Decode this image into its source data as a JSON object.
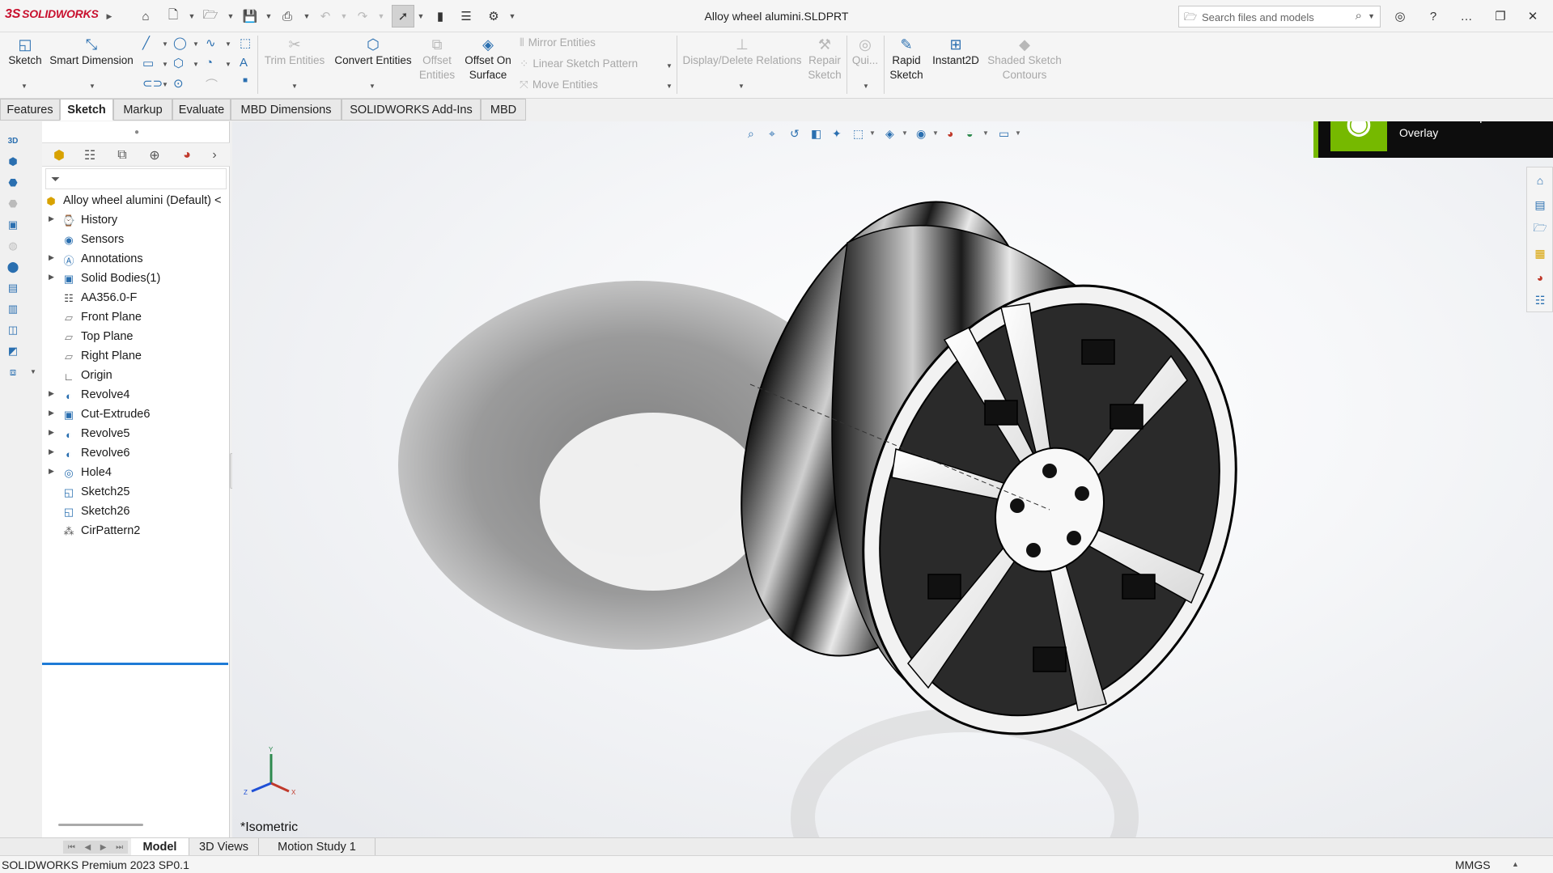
{
  "app": {
    "logo_text": "SOLIDWORKS",
    "logo_mark": "3S"
  },
  "title_bar": {
    "document_title": "Alloy wheel alumini.SLDPRT",
    "search_placeholder": "Search files and models"
  },
  "command_manager": {
    "sketch": "Sketch",
    "smart_dimension": "Smart Dimension",
    "trim_entities": "Trim Entities",
    "convert_entities": "Convert Entities",
    "offset_entities_1": "Offset",
    "offset_entities_2": "Entities",
    "offset_on_surface_1": "Offset On",
    "offset_on_surface_2": "Surface",
    "mirror_entities": "Mirror Entities",
    "linear_sketch_pattern": "Linear Sketch Pattern",
    "move_entities": "Move Entities",
    "display_delete_relations": "Display/Delete Relations",
    "repair_sketch_1": "Repair",
    "repair_sketch_2": "Sketch",
    "quick_snaps": "Qui...",
    "rapid_sketch_1": "Rapid",
    "rapid_sketch_2": "Sketch",
    "instant2d": "Instant2D",
    "shaded_sketch_1": "Shaded Sketch",
    "shaded_sketch_2": "Contours"
  },
  "tabs": [
    "Features",
    "Sketch",
    "Markup",
    "Evaluate",
    "MBD Dimensions",
    "SOLIDWORKS Add-Ins",
    "MBD"
  ],
  "active_tab": "Sketch",
  "feature_tree": {
    "root": "Alloy wheel alumini (Default) <",
    "items": [
      {
        "label": "History"
      },
      {
        "label": "Sensors"
      },
      {
        "label": "Annotations"
      },
      {
        "label": "Solid Bodies(1)"
      },
      {
        "label": "AA356.0-F"
      },
      {
        "label": "Front Plane"
      },
      {
        "label": "Top Plane"
      },
      {
        "label": "Right Plane"
      },
      {
        "label": "Origin"
      },
      {
        "label": "Revolve4"
      },
      {
        "label": "Cut-Extrude6"
      },
      {
        "label": "Revolve5"
      },
      {
        "label": "Revolve6"
      },
      {
        "label": "Hole4"
      },
      {
        "label": "Sketch25"
      },
      {
        "label": "Sketch26"
      },
      {
        "label": "CirPattern2"
      }
    ]
  },
  "overlay": {
    "nvidia_text": "Press Alt+Z to open NVIDIA Overlay"
  },
  "viewport": {
    "view_label": "*Isometric",
    "triad": {
      "x": "X",
      "y": "Y",
      "z": "Z"
    }
  },
  "bottom_tabs": [
    "Model",
    "3D Views",
    "Motion Study 1"
  ],
  "active_bottom_tab": "Model",
  "status_bar": {
    "product": "SOLIDWORKS Premium 2023 SP0.1",
    "units": "MMGS"
  },
  "colors": {
    "brand_red": "#c8102e",
    "accent_blue": "#1e7bd6",
    "nvidia_green": "#76b900"
  }
}
